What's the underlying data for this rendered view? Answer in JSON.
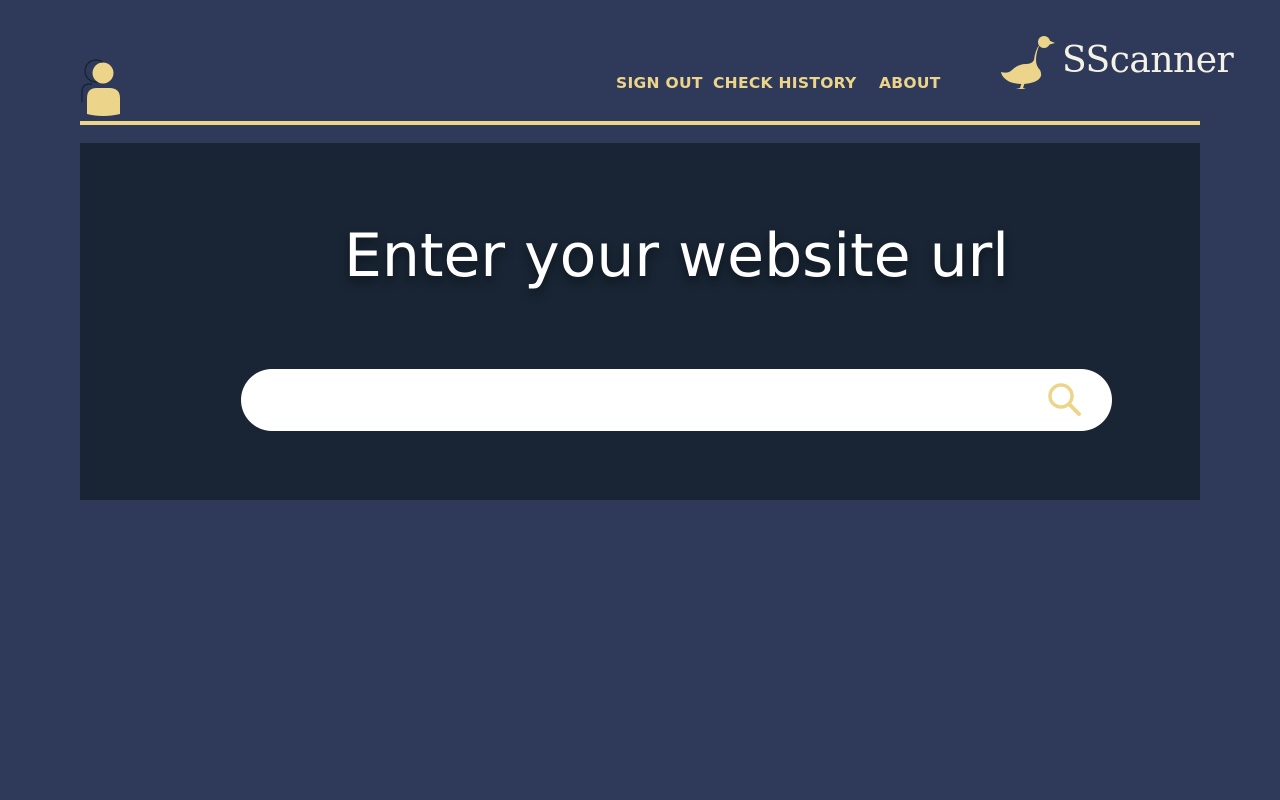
{
  "nav": {
    "sign_out": "SIGN OUT",
    "check_history": "CHECK HISTORY",
    "about": "ABOUT"
  },
  "brand": {
    "name": "SScanner",
    "logo_icon": "duck-icon"
  },
  "user": {
    "avatar_icon": "user-avatar-icon"
  },
  "main": {
    "headline": "Enter your website url",
    "search": {
      "value": "",
      "placeholder": "",
      "button_icon": "search-icon"
    }
  },
  "colors": {
    "background": "#2f3a5a",
    "panel": "#192534",
    "accent": "#ecd48a",
    "text_light": "#ffffff"
  }
}
